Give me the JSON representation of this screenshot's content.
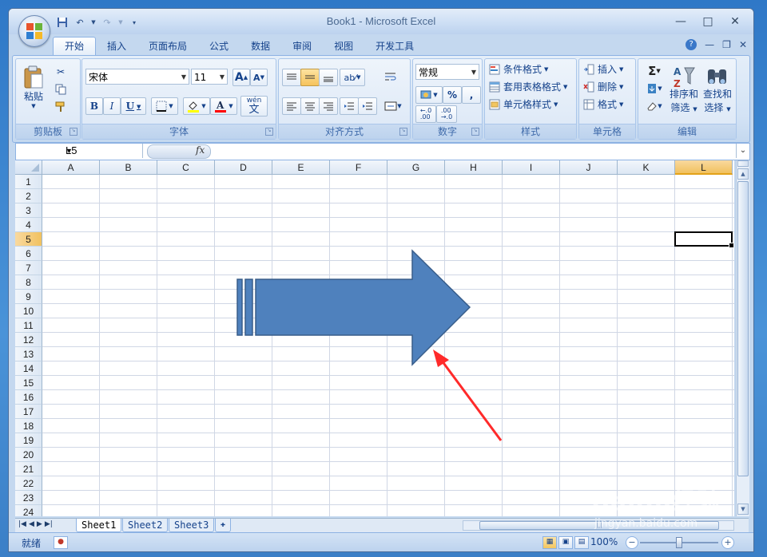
{
  "window": {
    "title": "Book1 - Microsoft Excel",
    "controls": [
      "—",
      "□",
      "✕"
    ]
  },
  "quick_access": [
    "save-icon",
    "undo-icon",
    "redo-icon",
    "customize-icon"
  ],
  "tabs": [
    {
      "label": "开始",
      "active": true
    },
    {
      "label": "插入"
    },
    {
      "label": "页面布局"
    },
    {
      "label": "公式"
    },
    {
      "label": "数据"
    },
    {
      "label": "审阅"
    },
    {
      "label": "视图"
    },
    {
      "label": "开发工具"
    }
  ],
  "ribbon": {
    "clipboard": {
      "title": "剪贴板",
      "paste": "粘贴"
    },
    "font": {
      "title": "字体",
      "name": "宋体",
      "size": "11",
      "bold": "B",
      "italic": "I",
      "underline": "U",
      "grow": "A",
      "shrink": "A",
      "phonetic": "wén"
    },
    "alignment": {
      "title": "对齐方式"
    },
    "number": {
      "title": "数字",
      "format": "常规",
      "percent": "%",
      "comma": ",",
      "inc_decimal": "+.0 .00",
      "dec_decimal": ".00 →.0"
    },
    "styles": {
      "title": "样式",
      "conditional": "条件格式",
      "table": "套用表格格式",
      "cell": "单元格样式"
    },
    "cells": {
      "title": "单元格",
      "insert": "插入",
      "delete": "删除",
      "format": "格式"
    },
    "editing": {
      "title": "编辑",
      "sum": "Σ",
      "sort": "排序和\n筛选",
      "sort_line1": "排序和",
      "sort_line2": "筛选",
      "find_line1": "查找和",
      "find_line2": "选择"
    }
  },
  "formula_bar": {
    "name_box": "L5",
    "fx": "fx",
    "value": ""
  },
  "grid": {
    "columns": [
      "A",
      "B",
      "C",
      "D",
      "E",
      "F",
      "G",
      "H",
      "I",
      "J",
      "K",
      "L"
    ],
    "rows": [
      "1",
      "2",
      "3",
      "4",
      "5",
      "6",
      "7",
      "8",
      "9",
      "10",
      "11",
      "12",
      "13",
      "14",
      "15",
      "16",
      "17",
      "18",
      "19",
      "20",
      "21",
      "22",
      "23",
      "24"
    ],
    "selected_column": "L",
    "selected_row": "5"
  },
  "sheets": [
    {
      "label": "Sheet1",
      "active": true
    },
    {
      "label": "Sheet2"
    },
    {
      "label": "Sheet3"
    }
  ],
  "status": {
    "ready": "就绪",
    "zoom": "100%"
  },
  "shape": {
    "type": "notched-right-arrow",
    "fill": "#4f81bd",
    "stroke": "#385d8a"
  },
  "annotation": {
    "type": "red-arrow",
    "color": "#ff2a2a"
  },
  "watermark": {
    "text": "Baidu经验",
    "sub": "jingyan.baidu.com"
  }
}
